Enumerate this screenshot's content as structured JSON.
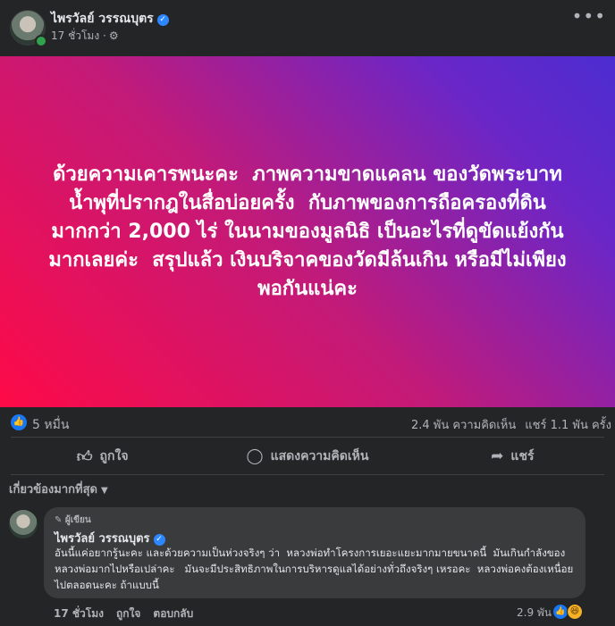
{
  "post": {
    "author": "ไพรวัลย์ วรรณบุตร",
    "time": "17 ชั่วโมง ·",
    "text": "ด้วยความเคารพนะคะ ￼ ภาพความขาดแคลน￼ ของวัดพระบาทน้ำพุที่ปรากฎในสื่อบ่อยครั้ง ￼ กับภาพของการถือครองที่ดินมากกว่า 2,000 ไร่￼ ในนามของมูลนิธิ เป็นอะไรที่ดูขัดแย้งกันมากเลยค่ะ ￼ สรุปแล้ว เงินบริจาคของวัดมีล้นเกิน หรือมีไม่เพียงพอกันแน่คะ",
    "gradient": [
      "#fe0a47",
      "#4b2dd0"
    ]
  },
  "stats": {
    "reactions": "5 หมื่น",
    "comments": "2.4 พัน ความคิดเห็น",
    "shares": "แชร์ 1.1 พัน ครั้ง"
  },
  "actions": {
    "like": "ถูกใจ",
    "comment": "แสดงความคิดเห็น",
    "share": "แชร์"
  },
  "sort_label": "เกี่ยวข้องมากที่สุด",
  "comment": {
    "badge": "ผู้เขียน",
    "author": "ไพรวัลย์ วรรณบุตร",
    "text": "อันนี้แค่อยากรู้นะคะ และด้วยความเป็นห่วงจริงๆ ว่า ￼ หลวงพ่อทำโครงการเยอะแยะมากมายขนาดนี้ ￼ มันเกินกำลังของหลวงพ่อมากไปหรือเปล่าคะ ￼￼ ￼ มันจะมีประสิทธิภาพในการบริหารดูแลได้อย่างทั่วถึงจริงๆ เหรอคะ ￼ หลวงพ่อคงต้องเหนื่อยไปตลอดนะคะ ถ้าแบบนี้",
    "time": "17 ชั่วโมง",
    "like": "ถูกใจ",
    "reply": "ตอบกลับ",
    "reaction_count": "2.9 พัน"
  },
  "icons": {
    "verified": "verified-badge-icon",
    "globe": "globe-icon",
    "more": "more-options-icon",
    "like": "like-icon",
    "comment": "comment-icon",
    "share": "share-icon"
  },
  "colors": {
    "background": "#242526",
    "accent": "#1877f2"
  }
}
